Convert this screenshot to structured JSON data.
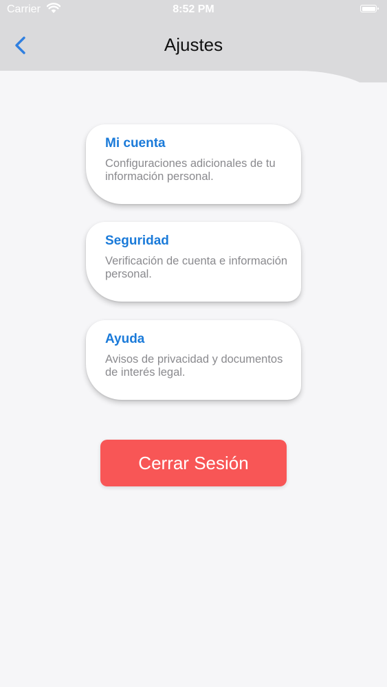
{
  "status_bar": {
    "carrier": "Carrier",
    "time": "8:52 PM",
    "icons": [
      "wifi-icon",
      "battery-icon"
    ]
  },
  "header": {
    "title": "Ajustes",
    "back_icon": "chevron-left-icon"
  },
  "menu": {
    "items": [
      {
        "title": "Mi cuenta",
        "description": "Configuraciones adicionales de tu información personal."
      },
      {
        "title": "Seguridad",
        "description": "Verificación de cuenta e información personal."
      },
      {
        "title": "Ayuda",
        "description": "Avisos de privacidad y documentos de interés legal."
      }
    ]
  },
  "logout": {
    "label": "Cerrar Sesión"
  },
  "colors": {
    "accent": "#1a7ad9",
    "logout": "#f85656",
    "header_bg": "#dadadc",
    "content_bg": "#f6f6f8",
    "description": "#8a8a8e"
  }
}
